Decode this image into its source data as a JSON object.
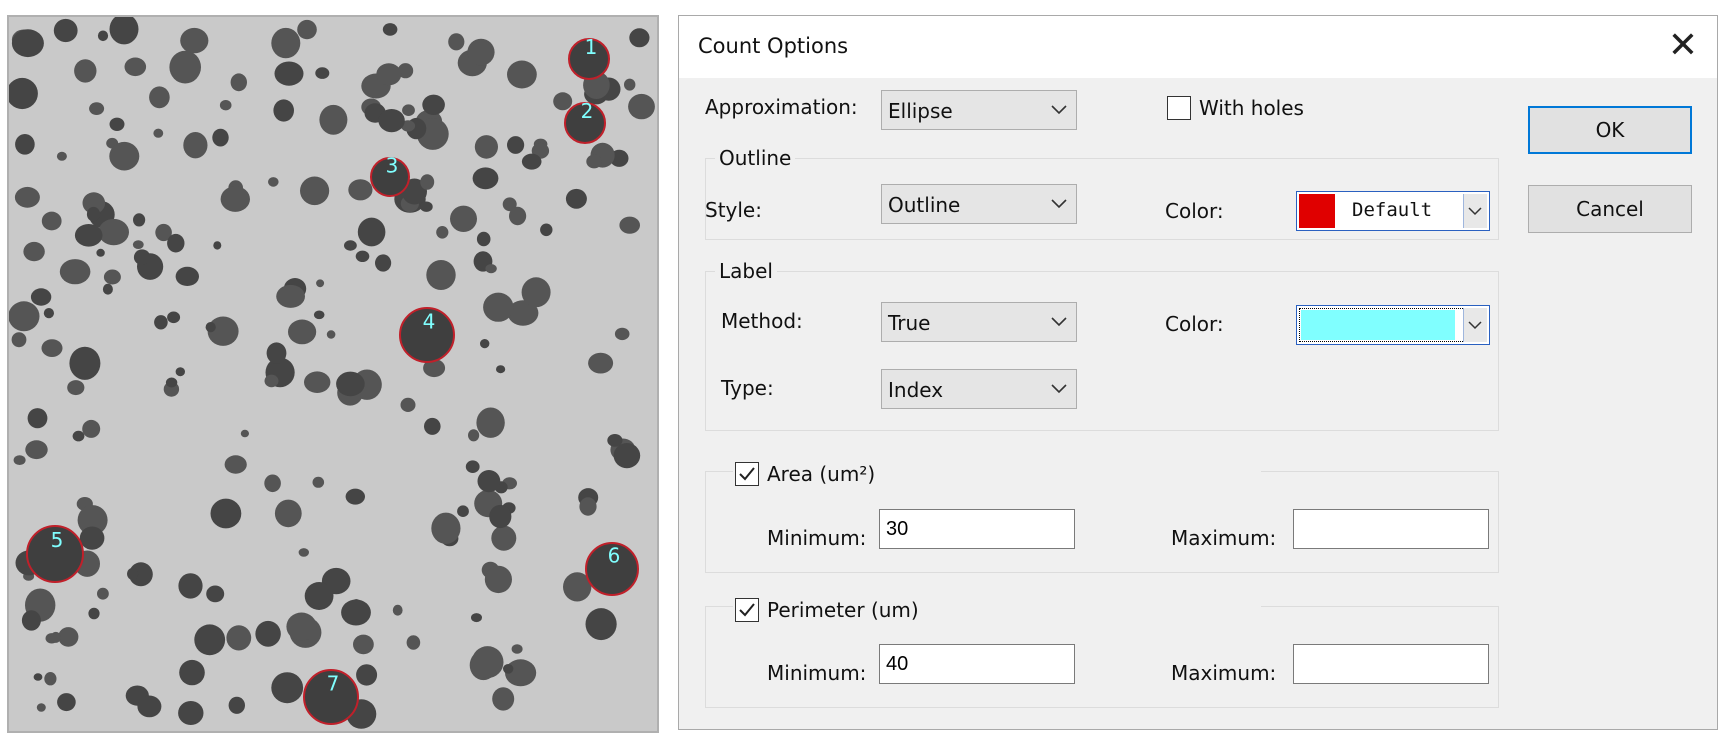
{
  "dialog": {
    "title": "Count Options",
    "approximation": {
      "label": "Approximation:",
      "value": "Ellipse"
    },
    "with_holes": {
      "label": "With holes",
      "checked": false
    },
    "outline": {
      "group_label": "Outline",
      "style_label": "Style:",
      "style_value": "Outline",
      "color_label": "Color:",
      "color_value": "Default",
      "color_swatch": "#e00000"
    },
    "label": {
      "group_label": "Label",
      "method_label": "Method:",
      "method_value": "True",
      "type_label": "Type:",
      "type_value": "Index",
      "color_label": "Color:",
      "color_swatch": "#80ffff"
    },
    "area": {
      "check_label": "Area (um²)",
      "checked": true,
      "min_label": "Minimum:",
      "min_value": "30",
      "max_label": "Maximum:",
      "max_value": ""
    },
    "perimeter": {
      "check_label": "Perimeter (um)",
      "checked": true,
      "min_label": "Minimum:",
      "min_value": "40",
      "max_label": "Maximum:",
      "max_value": ""
    },
    "buttons": {
      "ok": "OK",
      "cancel": "Cancel"
    }
  },
  "micrograph": {
    "outline_color": "#c0202a",
    "label_color": "#80ffff",
    "particle_labels": [
      "1",
      "2",
      "3",
      "4",
      "5",
      "6",
      "7"
    ]
  }
}
